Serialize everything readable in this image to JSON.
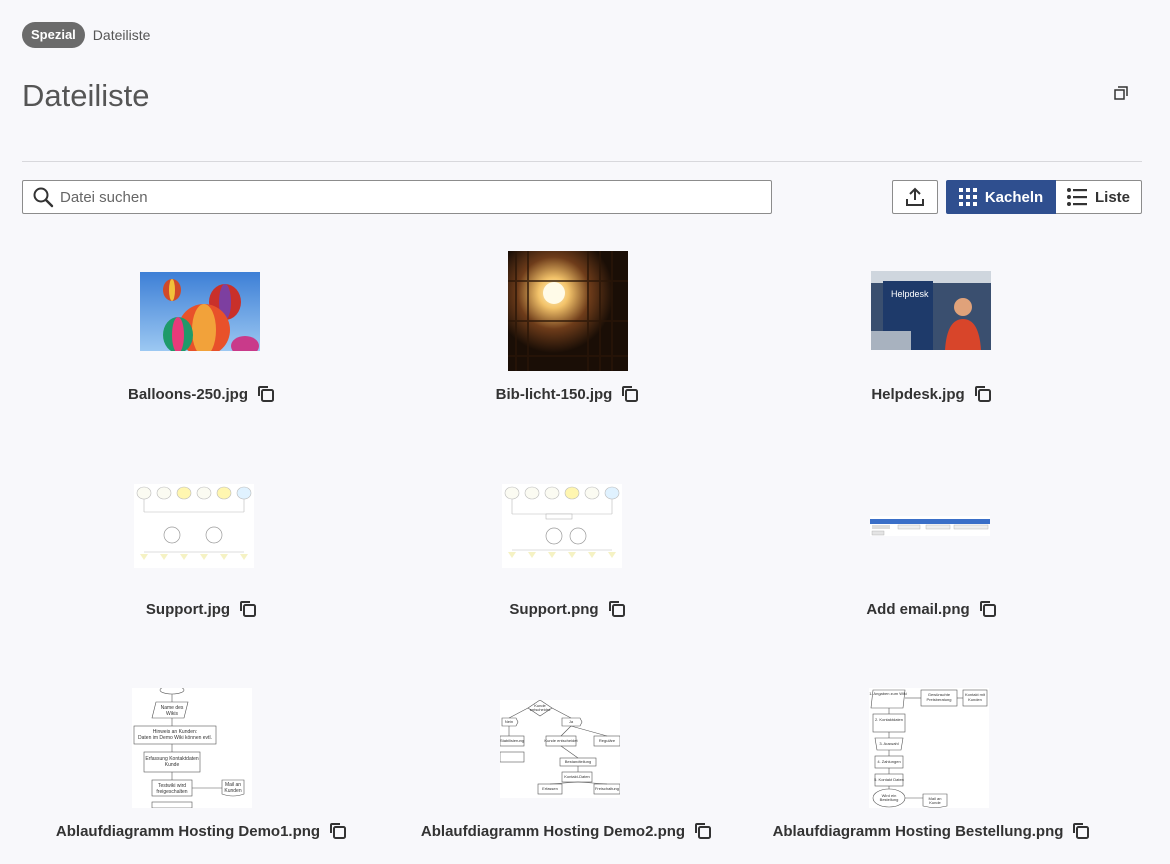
{
  "breadcrumb": {
    "badge": "Spezial",
    "current": "Dateiliste"
  },
  "page": {
    "title": "Dateiliste"
  },
  "search": {
    "placeholder": "Datei suchen",
    "value": ""
  },
  "view_toggle": {
    "tiles_label": "Kacheln",
    "list_label": "Liste",
    "active": "tiles"
  },
  "colors": {
    "accent": "#2f4f8f",
    "badge": "#6b6b6b"
  },
  "files": [
    {
      "name": "Balloons-250.jpg",
      "thumb": "balloons"
    },
    {
      "name": "Bib-licht-150.jpg",
      "thumb": "library-lamp"
    },
    {
      "name": "Helpdesk.jpg",
      "thumb": "helpdesk"
    },
    {
      "name": "Support.jpg",
      "thumb": "diagram"
    },
    {
      "name": "Support.png",
      "thumb": "diagram"
    },
    {
      "name": "Add email.png",
      "thumb": "form-screenshot"
    },
    {
      "name": "Ablaufdiagramm Hosting Demo1.png",
      "thumb": "flowchart"
    },
    {
      "name": "Ablaufdiagramm Hosting Demo2.png",
      "thumb": "flowchart"
    },
    {
      "name": "Ablaufdiagramm Hosting Bestellung.png",
      "thumb": "flowchart"
    }
  ]
}
